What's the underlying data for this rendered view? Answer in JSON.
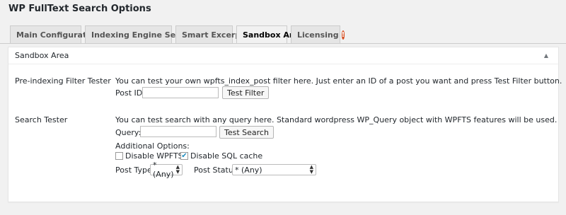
{
  "page": {
    "title": "WP FullText Search Options"
  },
  "tabs": [
    {
      "label": "Main Configuration"
    },
    {
      "label": "Indexing Engine Settings"
    },
    {
      "label": "Smart Excerpts"
    },
    {
      "label": "Sandbox Area"
    },
    {
      "label": "Licensing",
      "badge": "!"
    }
  ],
  "postbox": {
    "title": "Sandbox Area",
    "toggle_icon": "triangle-up-icon"
  },
  "filter_tester": {
    "label": "Pre-indexing Filter Tester",
    "description": "You can test your own wpfts_index_post filter here. Just enter an ID of a post you want and press Test Filter button.",
    "post_id_label": "Post ID:",
    "post_id_value": "",
    "button_label": "Test Filter"
  },
  "search_tester": {
    "label": "Search Tester",
    "description": "You can test search with any query here. Standard wordpress WP_Query object with WPFTS features will be used.",
    "query_label": "Query:",
    "query_value": "",
    "button_label": "Test Search",
    "additional_options_label": "Additional Options:",
    "disable_wpfts": {
      "label": "Disable WPFTS",
      "checked": false
    },
    "disable_sql_cache": {
      "label": "Disable SQL cache",
      "checked": true
    },
    "post_type_label": "Post Type:",
    "post_type_value": "* (Any)",
    "post_status_label": "Post Status:",
    "post_status_value": "* (Any)"
  },
  "colors": {
    "badge": "#d54e21",
    "check": "#1e8cbe"
  }
}
